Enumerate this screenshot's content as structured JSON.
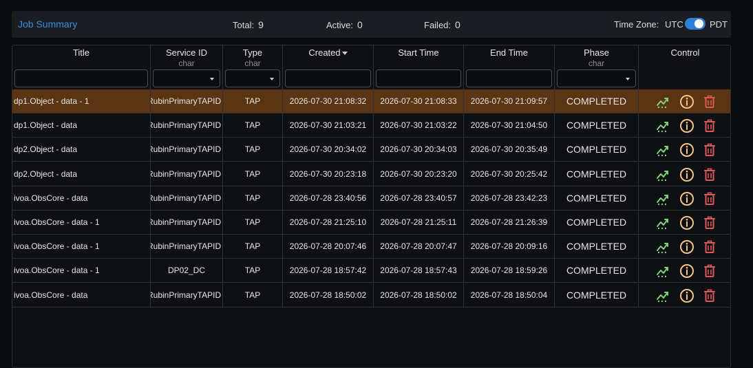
{
  "summary": {
    "title": "Job Summary",
    "total_label": "Total:",
    "total_value": "9",
    "active_label": "Active:",
    "active_value": "0",
    "failed_label": "Failed:",
    "failed_value": "0",
    "timezone_label": "Time Zone:",
    "tz_left": "UTC",
    "tz_right": "PDT",
    "tz_selected": "PDT"
  },
  "columns": [
    {
      "label": "Title",
      "sub": ""
    },
    {
      "label": "Service ID",
      "sub": "char"
    },
    {
      "label": "Type",
      "sub": "char"
    },
    {
      "label": "Created",
      "sub": ""
    },
    {
      "label": "Start Time",
      "sub": ""
    },
    {
      "label": "End Time",
      "sub": ""
    },
    {
      "label": "Phase",
      "sub": "char"
    },
    {
      "label": "Control",
      "sub": ""
    }
  ],
  "rows": [
    {
      "title": "dp1.Object - data - 1",
      "service": "RubinPrimaryTAPID",
      "type": "TAP",
      "created": "2026-07-30 21:08:32",
      "start": "2026-07-30 21:08:33",
      "end": "2026-07-30 21:09:57",
      "phase": "COMPLETED"
    },
    {
      "title": "dp1.Object - data",
      "service": "RubinPrimaryTAPID",
      "type": "TAP",
      "created": "2026-07-30 21:03:21",
      "start": "2026-07-30 21:03:22",
      "end": "2026-07-30 21:04:50",
      "phase": "COMPLETED"
    },
    {
      "title": "dp2.Object - data",
      "service": "RubinPrimaryTAPID",
      "type": "TAP",
      "created": "2026-07-30 20:34:02",
      "start": "2026-07-30 20:34:03",
      "end": "2026-07-30 20:35:49",
      "phase": "COMPLETED"
    },
    {
      "title": "dp2.Object - data",
      "service": "RubinPrimaryTAPID",
      "type": "TAP",
      "created": "2026-07-30 20:23:18",
      "start": "2026-07-30 20:23:20",
      "end": "2026-07-30 20:25:42",
      "phase": "COMPLETED"
    },
    {
      "title": "ivoa.ObsCore - data",
      "service": "RubinPrimaryTAPID",
      "type": "TAP",
      "created": "2026-07-28 23:40:56",
      "start": "2026-07-28 23:40:57",
      "end": "2026-07-28 23:42:23",
      "phase": "COMPLETED"
    },
    {
      "title": "ivoa.ObsCore - data - 1",
      "service": "RubinPrimaryTAPID",
      "type": "TAP",
      "created": "2026-07-28 21:25:10",
      "start": "2026-07-28 21:25:11",
      "end": "2026-07-28 21:26:39",
      "phase": "COMPLETED"
    },
    {
      "title": "ivoa.ObsCore - data - 1",
      "service": "RubinPrimaryTAPID",
      "type": "TAP",
      "created": "2026-07-28 20:07:46",
      "start": "2026-07-28 20:07:47",
      "end": "2026-07-28 20:09:16",
      "phase": "COMPLETED"
    },
    {
      "title": "ivoa.ObsCore - data - 1",
      "service": "DP02_DC",
      "type": "TAP",
      "created": "2026-07-28 18:57:42",
      "start": "2026-07-28 18:57:43",
      "end": "2026-07-28 18:59:26",
      "phase": "COMPLETED"
    },
    {
      "title": "ivoa.ObsCore - data",
      "service": "RubinPrimaryTAPID",
      "type": "TAP",
      "created": "2026-07-28 18:50:02",
      "start": "2026-07-28 18:50:02",
      "end": "2026-07-28 18:50:04",
      "phase": "COMPLETED"
    }
  ],
  "selected_row": 0,
  "colors": {
    "accent": "#3b8fd9",
    "selected_row": "#5a3413",
    "chart_icon": "#7fd17a",
    "info_icon": "#f2c589",
    "delete_icon": "#e05757"
  },
  "icons": {
    "chart": "chart-line-icon",
    "info": "info-icon",
    "delete": "trash-icon"
  }
}
